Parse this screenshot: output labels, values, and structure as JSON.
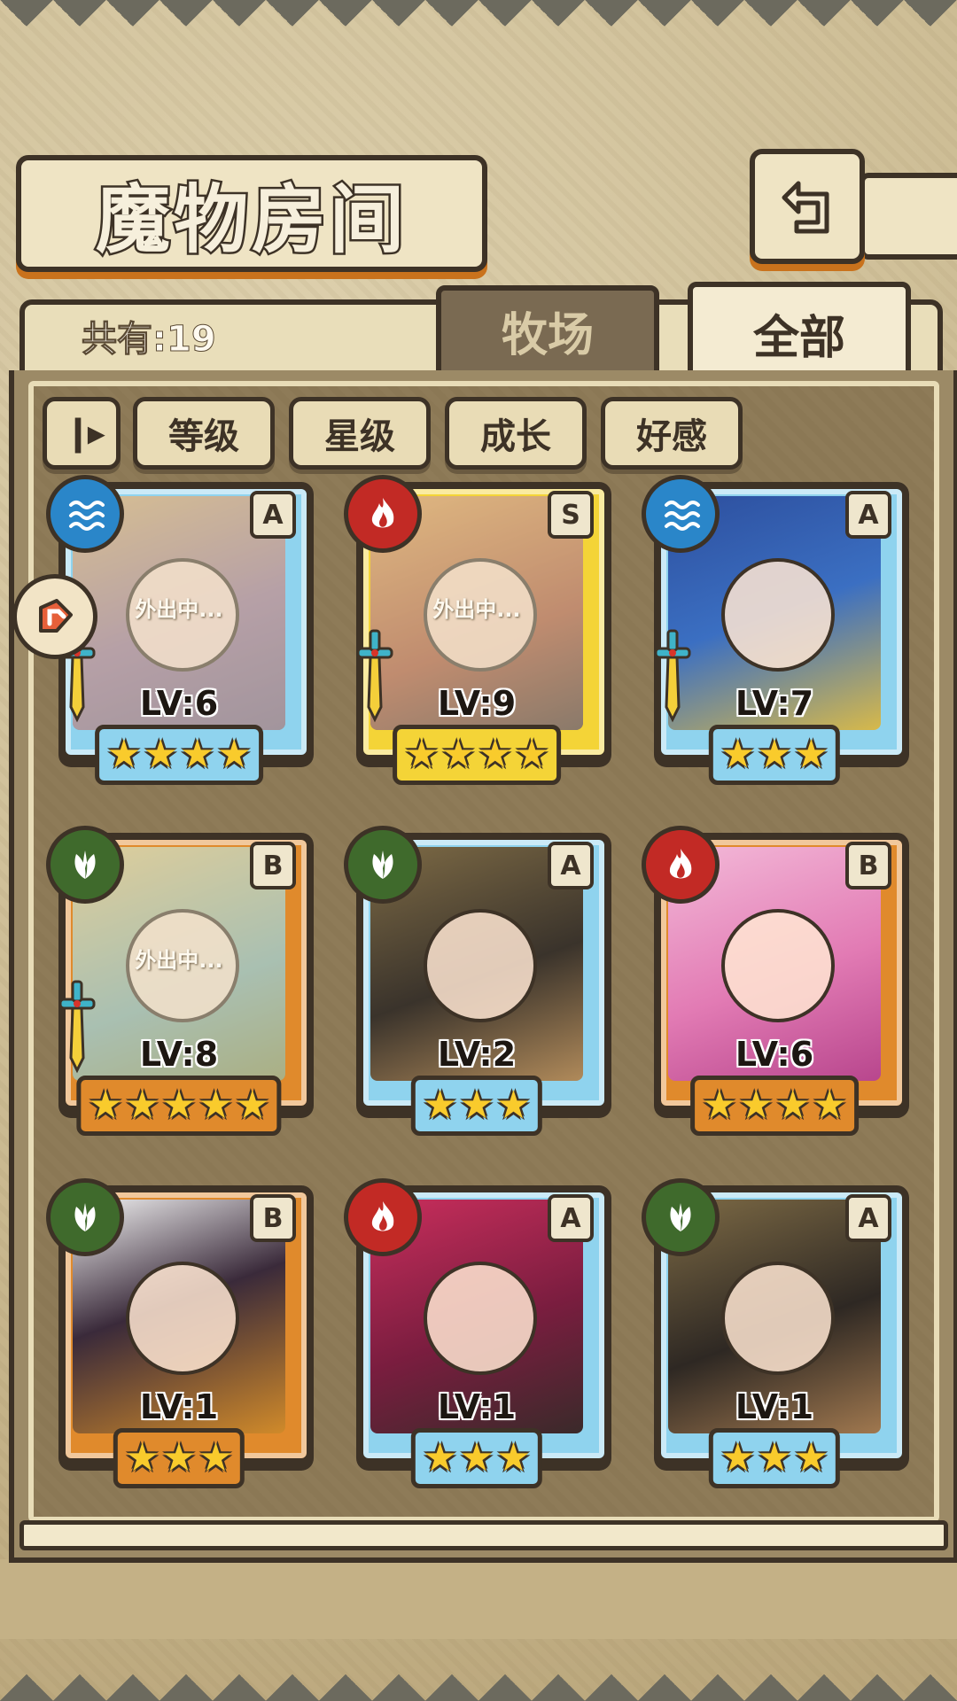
{
  "header": {
    "title": "魔物房间",
    "back_icon": "return-arrow-icon"
  },
  "tabs": {
    "count_label": "共有:19",
    "items": [
      {
        "label": "牧场",
        "active": false
      },
      {
        "label": "全部",
        "active": true
      }
    ]
  },
  "filters": {
    "sort_icon": "sort-order-icon",
    "items": [
      {
        "label": "等级"
      },
      {
        "label": "星级"
      },
      {
        "label": "成长"
      },
      {
        "label": "好感"
      }
    ]
  },
  "side_badge_icon": "quest-tag-icon",
  "monsters": [
    {
      "element": "water",
      "rarity": "A",
      "level": "LV:6",
      "stars": 4,
      "status": "外出中...",
      "has_weapon": true,
      "frame": "blue"
    },
    {
      "element": "fire",
      "rarity": "S",
      "level": "LV:9",
      "stars": 4,
      "status": "外出中...",
      "has_weapon": true,
      "frame": "gold"
    },
    {
      "element": "water",
      "rarity": "A",
      "level": "LV:7",
      "stars": 3,
      "status": "",
      "has_weapon": true,
      "frame": "blue"
    },
    {
      "element": "grass",
      "rarity": "B",
      "level": "LV:8",
      "stars": 5,
      "status": "外出中...",
      "has_weapon": true,
      "frame": "bronze"
    },
    {
      "element": "grass",
      "rarity": "A",
      "level": "LV:2",
      "stars": 3,
      "status": "",
      "has_weapon": false,
      "frame": "blue"
    },
    {
      "element": "fire",
      "rarity": "B",
      "level": "LV:6",
      "stars": 4,
      "status": "",
      "has_weapon": false,
      "frame": "bronze"
    },
    {
      "element": "grass",
      "rarity": "B",
      "level": "LV:1",
      "stars": 3,
      "status": "",
      "has_weapon": false,
      "frame": "bronze"
    },
    {
      "element": "fire",
      "rarity": "A",
      "level": "LV:1",
      "stars": 3,
      "status": "",
      "has_weapon": false,
      "frame": "blue"
    },
    {
      "element": "grass",
      "rarity": "A",
      "level": "LV:1",
      "stars": 3,
      "status": "",
      "has_weapon": false,
      "frame": "blue"
    }
  ],
  "colors": {
    "frame_blue": "#8fd3ee",
    "frame_gold": "#f4d437",
    "frame_bronze": "#e08a2c",
    "water": "#2a86c9",
    "fire": "#c22a25",
    "grass": "#3f6a2c"
  }
}
